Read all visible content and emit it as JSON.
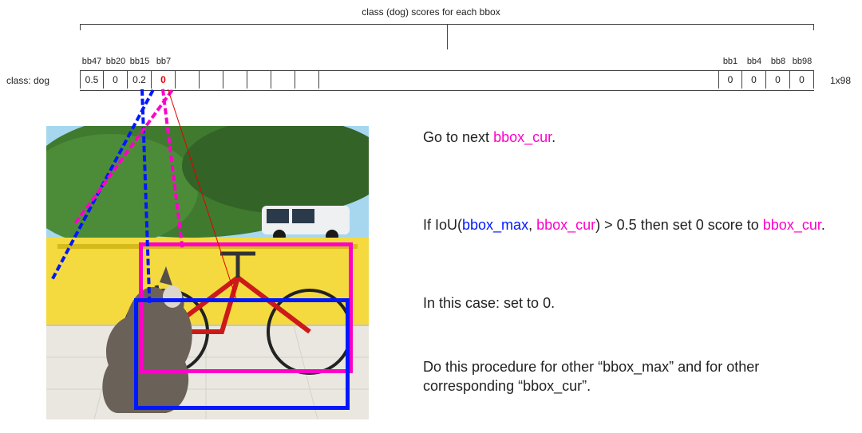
{
  "chart_data": {
    "type": "table",
    "title": "class (dog) scores for each bbox",
    "row_label": "class: dog",
    "dim_label": "1x98",
    "columns": [
      "bb47",
      "bb20",
      "bb15",
      "bb7",
      "bb1",
      "bb4",
      "bb8",
      "bb98"
    ],
    "values": [
      "0.5",
      "0",
      "0.2",
      "0",
      "0",
      "0",
      "0",
      "0"
    ],
    "highlight_col": "bb7",
    "n_total_cols": 98,
    "bbox_max_ref": "bb15",
    "bbox_cur_ref": "bb7"
  },
  "top_title": "class (dog) scores for each bbox",
  "class_label": "class: dog",
  "dim_label": "1x98",
  "row": {
    "bb47": {
      "label": "bb47",
      "val": "0.5"
    },
    "bb20": {
      "label": "bb20",
      "val": "0"
    },
    "bb15": {
      "label": "bb15",
      "val": "0.2"
    },
    "bb7": {
      "label": "bb7",
      "val": "0"
    },
    "bb1": {
      "label": "bb1",
      "val": "0"
    },
    "bb4": {
      "label": "bb4",
      "val": "0"
    },
    "bb8": {
      "label": "bb8",
      "val": "0"
    },
    "bb98": {
      "label": "bb98",
      "val": "0"
    }
  },
  "text": {
    "line1_a": "Go to next ",
    "line1_b": "bbox_cur",
    "line1_c": ".",
    "line2_a": "If IoU(",
    "line2_b": "bbox_max",
    "line2_c": ", ",
    "line2_d": "bbox_cur",
    "line2_e": ") > 0.5 then set 0 score to ",
    "line2_f": "bbox_cur",
    "line2_g": ".",
    "line3": "In this case: set to 0.",
    "line4": "Do this procedure for other “bbox_max” and for other corresponding “bbox_cur”."
  }
}
